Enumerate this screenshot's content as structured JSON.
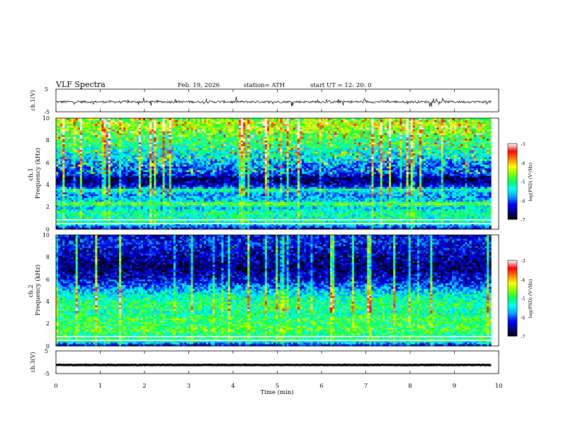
{
  "header": {
    "title": "VLF  Spectra",
    "date": "Feb. 19, 2026",
    "station": "station= ATH",
    "start": "start  UT  =   12: 20: 0"
  },
  "chart_data": [
    {
      "type": "line",
      "name": "ch1-waveform",
      "ylabel": "ch.1(V)",
      "ylim": [
        -5,
        5
      ],
      "yticks": [
        "5",
        "-5"
      ],
      "xlim": [
        0,
        10
      ],
      "baseline": -0.6,
      "noise_amplitude": 0.5,
      "data_end_min": 9.83
    },
    {
      "type": "heatmap",
      "name": "ch1-spectrogram",
      "ylabel": "ch.1\nFrequency  (kHz)",
      "ylim": [
        0,
        10
      ],
      "yticks": [
        "0",
        "2",
        "4",
        "6",
        "8",
        "10"
      ],
      "xlim": [
        0,
        10
      ],
      "data_end_min": 9.83,
      "colorbar": {
        "label": "log(PSD) (V²/Hz)",
        "range": [
          -7,
          -3
        ],
        "ticks": [
          "-3",
          "-4",
          "-5",
          "-6",
          "-7"
        ]
      },
      "profile": [
        [
          0.0,
          -6.6
        ],
        [
          0.6,
          -5.2
        ],
        [
          1.0,
          -5.3
        ],
        [
          1.5,
          -5.1
        ],
        [
          2.0,
          -5.7
        ],
        [
          2.3,
          -4.6
        ],
        [
          2.6,
          -5.6
        ],
        [
          3.2,
          -5.8
        ],
        [
          3.6,
          -5.1
        ],
        [
          3.8,
          -6.1
        ],
        [
          4.2,
          -6.6
        ],
        [
          4.6,
          -6.7
        ],
        [
          5.0,
          -6.1
        ],
        [
          5.4,
          -6.0
        ],
        [
          6.0,
          -5.8
        ],
        [
          6.5,
          -5.5
        ],
        [
          7.0,
          -5.4
        ],
        [
          7.5,
          -5.1
        ],
        [
          8.0,
          -5.0
        ],
        [
          8.5,
          -4.8
        ],
        [
          9.0,
          -4.6
        ],
        [
          9.5,
          -4.4
        ],
        [
          10.0,
          -4.7
        ]
      ]
    },
    {
      "type": "heatmap",
      "name": "ch2-spectrogram",
      "ylabel": "ch.2\nFrequency  (kHz)",
      "ylim": [
        0,
        10
      ],
      "yticks": [
        "0",
        "2",
        "4",
        "6",
        "8",
        "10"
      ],
      "xlim": [
        0,
        10
      ],
      "data_end_min": 9.83,
      "colorbar": {
        "label": "log(PSD) (V²/Hz)",
        "range": [
          -7,
          -3
        ],
        "ticks": [
          "-3",
          "-4",
          "-5",
          "-6",
          "-7"
        ]
      },
      "profile": [
        [
          0.0,
          -6.6
        ],
        [
          0.5,
          -5.0
        ],
        [
          1.0,
          -5.1
        ],
        [
          1.5,
          -4.8
        ],
        [
          2.0,
          -5.0
        ],
        [
          2.5,
          -4.9
        ],
        [
          3.0,
          -5.2
        ],
        [
          3.5,
          -5.0
        ],
        [
          4.0,
          -5.1
        ],
        [
          4.5,
          -5.3
        ],
        [
          5.0,
          -5.6
        ],
        [
          5.5,
          -6.0
        ],
        [
          6.0,
          -6.3
        ],
        [
          6.5,
          -6.5
        ],
        [
          7.0,
          -6.7
        ],
        [
          7.5,
          -6.6
        ],
        [
          8.0,
          -6.5
        ],
        [
          8.5,
          -6.4
        ],
        [
          9.0,
          -6.3
        ],
        [
          9.5,
          -6.2
        ],
        [
          10.0,
          -6.4
        ]
      ]
    },
    {
      "type": "line",
      "name": "ch3-waveform",
      "ylabel": "ch.3(V)",
      "ylim": [
        -5,
        5
      ],
      "yticks": [
        "5",
        "-5"
      ],
      "xlim": [
        0,
        10
      ],
      "baseline": -1.2,
      "noise_amplitude": 0.1,
      "data_end_min": 9.83
    }
  ],
  "x_axis": {
    "label": "Time  (min)",
    "ticks": [
      "0",
      "1",
      "2",
      "3",
      "4",
      "5",
      "6",
      "7",
      "8",
      "9",
      "10"
    ]
  },
  "colors": {
    "colormap": [
      "#000000",
      "#00008a",
      "#0000ff",
      "#00a0ff",
      "#00ffff",
      "#00ff60",
      "#80ff00",
      "#ffff00",
      "#ff8000",
      "#ff0000",
      "#ffffff"
    ]
  }
}
